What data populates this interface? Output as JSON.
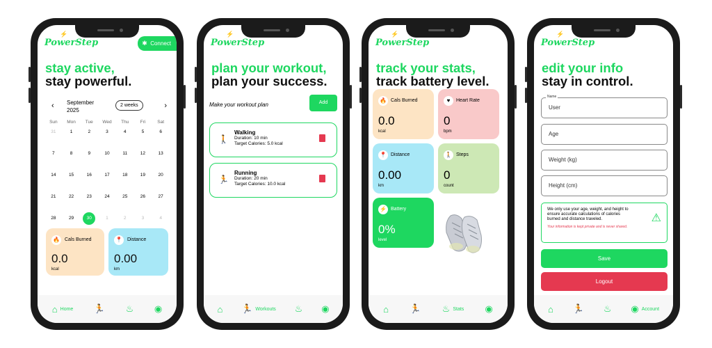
{
  "brand": {
    "name": "PowerStep",
    "accent": "#1ed760",
    "danger": "#e53950"
  },
  "home": {
    "connect_label": "Connect",
    "headline": [
      "stay active,",
      "stay powerful."
    ],
    "calendar": {
      "month": "September",
      "year": "2025",
      "range": "2 weeks",
      "days": [
        "Sun",
        "Mon",
        "Tue",
        "Wed",
        "Thu",
        "Fri",
        "Sat"
      ],
      "weeks": [
        [
          "31",
          "1",
          "2",
          "3",
          "4",
          "5",
          "6"
        ],
        [
          "7",
          "8",
          "9",
          "10",
          "11",
          "12",
          "13"
        ],
        [
          "14",
          "15",
          "16",
          "17",
          "18",
          "19",
          "20"
        ],
        [
          "21",
          "22",
          "23",
          "24",
          "25",
          "26",
          "27"
        ],
        [
          "28",
          "29",
          "30",
          "1",
          "2",
          "3",
          "4"
        ]
      ],
      "selected": "30"
    },
    "cards": [
      {
        "title": "Cals Burned",
        "value": "0.0",
        "unit": "kcal",
        "color": "#fde4c4"
      },
      {
        "title": "Distance",
        "value": "0.00",
        "unit": "km",
        "color": "#a8e8f7"
      }
    ],
    "nav_label": "Home"
  },
  "workouts": {
    "headline": [
      "plan your workout,",
      "plan your success."
    ],
    "prompt": "Make your workout plan",
    "add_label": "Add",
    "items": [
      {
        "name": "Walking",
        "duration": "Duration: 10 min",
        "target": "Target Calories: 5.0 kcal"
      },
      {
        "name": "Running",
        "duration": "Duration: 20 min",
        "target": "Target Calories: 10.0 kcal"
      }
    ],
    "nav_label": "Workouts"
  },
  "stats": {
    "headline": [
      "track your stats,",
      "track battery level."
    ],
    "cards": [
      {
        "title": "Cals Burned",
        "value": "0.0",
        "unit": "kcal",
        "color": "#fde4c4"
      },
      {
        "title": "Heart Rate",
        "value": "0",
        "unit": "bpm",
        "color": "#f9c9c9"
      },
      {
        "title": "Distance",
        "value": "0.00",
        "unit": "km",
        "color": "#a8e8f7"
      },
      {
        "title": "Steps",
        "value": "0",
        "unit": "count",
        "color": "#cde8b5"
      },
      {
        "title": "Battery",
        "value": "0%",
        "unit": "level",
        "color": "#1ed760"
      }
    ],
    "nav_label": "Stats"
  },
  "account": {
    "headline": [
      "edit your info",
      "stay in control."
    ],
    "name_legend": "Name",
    "fields": [
      "User",
      "Age",
      "Weight (kg)",
      "Height (cm)"
    ],
    "info": "We only use your age, weight, and height to ensure accurate calculations of calories burned and distance traveled.",
    "privacy": "Your information is kept private and is never shared.",
    "save_label": "Save",
    "logout_label": "Logout",
    "nav_label": "Account"
  }
}
